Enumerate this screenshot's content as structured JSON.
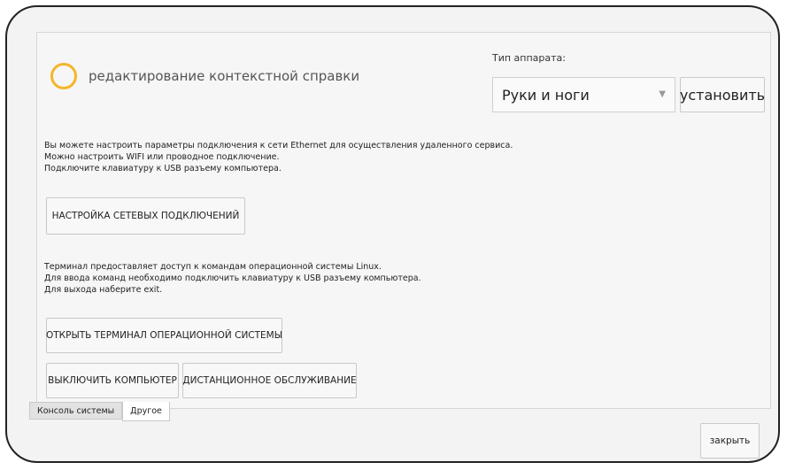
{
  "help": {
    "title": "редактирование контекстной справки"
  },
  "device": {
    "type_label": "Тип аппарата:",
    "selected": "Руки и ноги",
    "install_label": "установить"
  },
  "network": {
    "lines": [
      "Вы можете настроить параметры подключения к сети Ethernet для осуществления удаленного сервиса.",
      "Можно настроить WIFI или проводное подключение.",
      "Подключите клавиатуру к USB разъему компьютера."
    ],
    "button_label": "НАСТРОЙКА СЕТЕВЫХ ПОДКЛЮЧЕНИЙ"
  },
  "terminal": {
    "lines": [
      "Терминал предоставляет доступ к командам операционной системы Linux.",
      "Для ввода команд необходимо подключить клавиатуру к USB разъему компьютера.",
      "Для выхода наберите exit."
    ],
    "button_label": "ОТКРЫТЬ ТЕРМИНАЛ ОПЕРАЦИОННОЙ СИСТЕМЫ"
  },
  "actions": {
    "shutdown_label": "ВЫКЛЮЧИТЬ КОМПЬЮТЕР",
    "remote_label": "ДИСТАНЦИОННОЕ ОБСЛУЖИВАНИЕ"
  },
  "tabs": [
    {
      "label": "Консоль системы",
      "active": false
    },
    {
      "label": "Другое",
      "active": true
    }
  ],
  "close_label": "закрыть",
  "colors": {
    "spinner": "#f5b52a",
    "frame_border": "#222222"
  }
}
